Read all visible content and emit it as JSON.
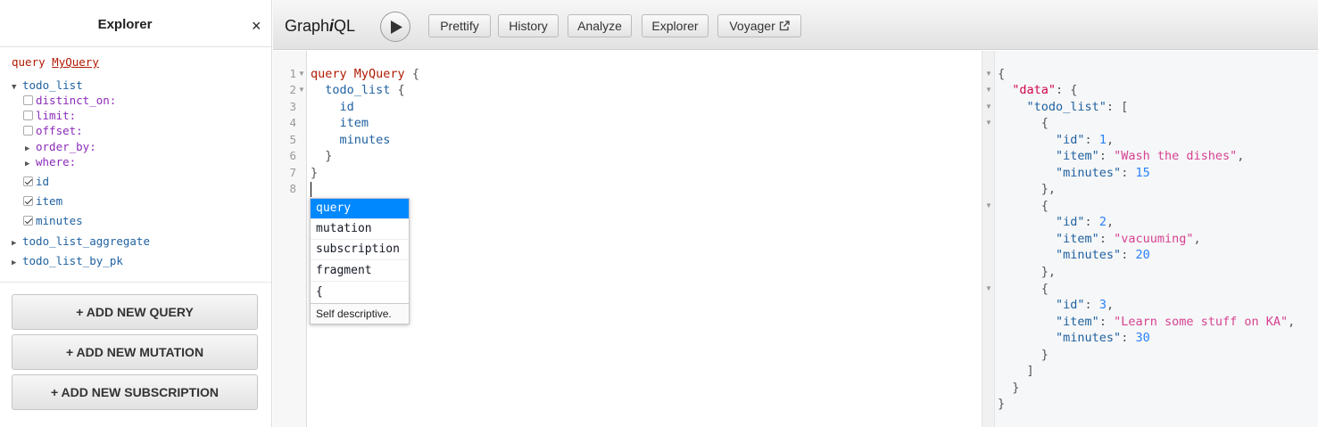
{
  "explorer": {
    "title": "Explorer",
    "close_icon": "×",
    "operation_keyword": "query",
    "operation_name": "MyQuery",
    "root_field": "todo_list",
    "args": [
      "distinct_on:",
      "limit:",
      "offset:",
      "order_by:",
      "where:"
    ],
    "fields": [
      {
        "name": "id",
        "checked": true
      },
      {
        "name": "item",
        "checked": true
      },
      {
        "name": "minutes",
        "checked": true
      }
    ],
    "other_roots": [
      "todo_list_aggregate",
      "todo_list_by_pk"
    ],
    "add_query": "+ ADD NEW QUERY",
    "add_mutation": "+ ADD NEW MUTATION",
    "add_subscription": "+ ADD NEW SUBSCRIPTION"
  },
  "toolbar": {
    "logo_prefix": "Graph",
    "logo_i": "i",
    "logo_suffix": "QL",
    "prettify": "Prettify",
    "history": "History",
    "analyze": "Analyze",
    "explorer": "Explorer",
    "voyager": "Voyager"
  },
  "editor": {
    "line_numbers": [
      "1",
      "2",
      "3",
      "4",
      "5",
      "6",
      "7",
      "8"
    ],
    "q_kw": "query",
    "q_name": "MyQuery",
    "brace_open": " {",
    "field": "todo_list",
    "f_id": "id",
    "f_item": "item",
    "f_minutes": "minutes",
    "brace_close_inner": "}",
    "brace_close": "}"
  },
  "autocomplete": {
    "items": [
      "query",
      "mutation",
      "subscription",
      "fragment",
      "{"
    ],
    "description": "Self descriptive."
  },
  "result": {
    "data_key": "\"data\"",
    "list_key": "\"todo_list\"",
    "id_key": "\"id\"",
    "item_key": "\"item\"",
    "minutes_key": "\"minutes\"",
    "rows": [
      {
        "id": "1",
        "item": "\"Wash the dishes\"",
        "minutes": "15"
      },
      {
        "id": "2",
        "item": "\"vacuuming\"",
        "minutes": "20"
      },
      {
        "id": "3",
        "item": "\"Learn some stuff on KA\"",
        "minutes": "30"
      }
    ]
  },
  "colors": {
    "keyword": "#b11a04",
    "field": "#1f61a0",
    "argument": "#8b2bb9",
    "string": "#d64292",
    "number": "#2882f9",
    "active_hint": "#0088ff"
  }
}
